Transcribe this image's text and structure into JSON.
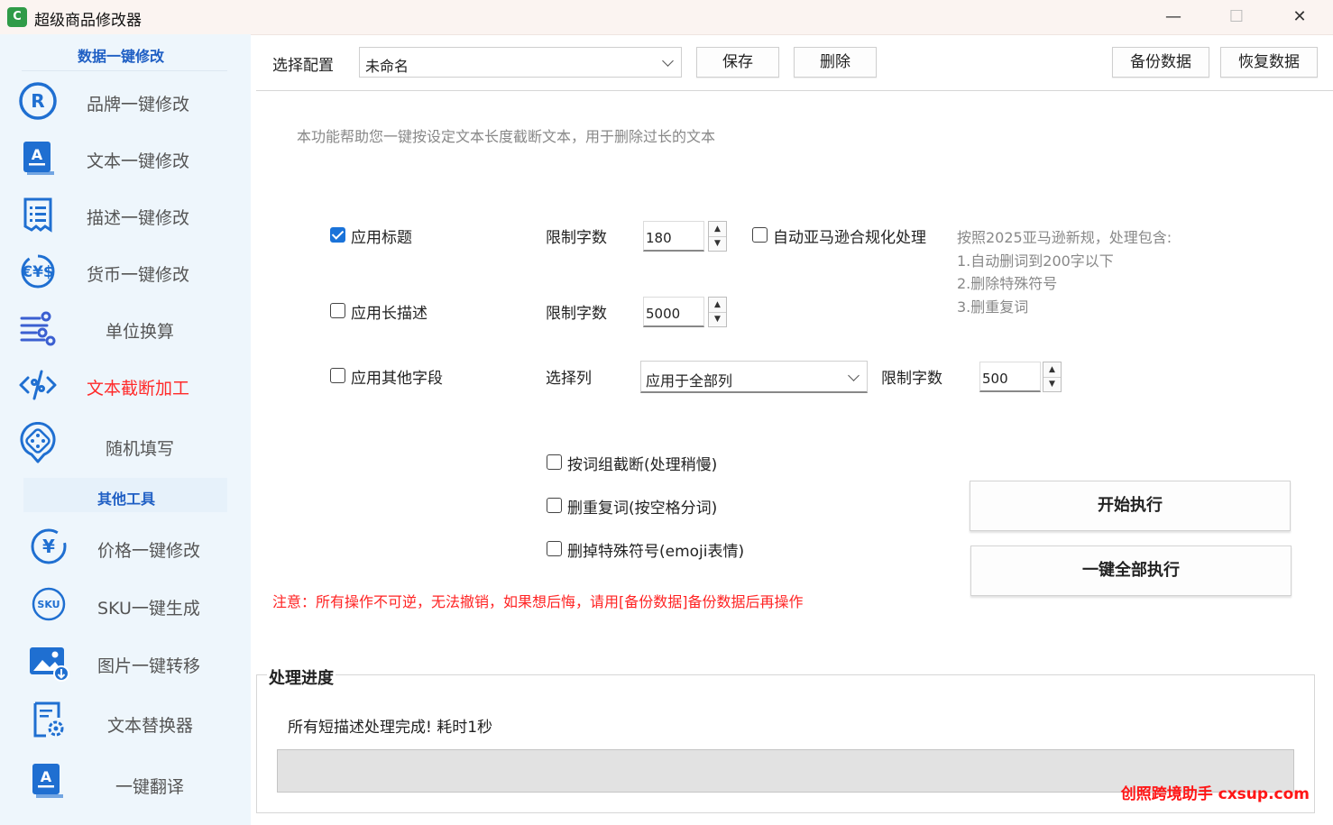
{
  "window": {
    "title": "超级商品修改器",
    "app_icon_glyph": "C",
    "minimize_glyph": "—",
    "maximize_glyph": "☐",
    "close_glyph": "✕"
  },
  "sidebar": {
    "section_main": "数据一键修改",
    "items": [
      {
        "label": "品牌一键修改",
        "icon": "registered-icon"
      },
      {
        "label": "文本一键修改",
        "icon": "document-a-icon"
      },
      {
        "label": "描述一键修改",
        "icon": "receipt-list-icon"
      },
      {
        "label": "货币一键修改",
        "icon": "currency-icon"
      },
      {
        "label": "单位换算",
        "icon": "sliders-icon"
      },
      {
        "label": "文本截断加工",
        "icon": "code-cut-icon",
        "active": true
      },
      {
        "label": "随机填写",
        "icon": "dice-pin-icon"
      }
    ],
    "section_other": "其他工具",
    "other_items": [
      {
        "label": "价格一键修改",
        "icon": "yuan-icon"
      },
      {
        "label": "SKU一键生成",
        "icon": "sku-icon"
      },
      {
        "label": "图片一键转移",
        "icon": "image-download-icon"
      },
      {
        "label": "文本替换器",
        "icon": "doc-gear-icon"
      },
      {
        "label": "一键翻译",
        "icon": "translate-doc-icon"
      }
    ],
    "sku_text": "SKU",
    "active_color": "#ff2a2a",
    "icon_color": "#1f6fd1"
  },
  "topbar": {
    "config_label": "选择配置",
    "config_value": "未命名",
    "save_label": "保存",
    "delete_label": "删除",
    "backup_label": "备份数据",
    "restore_label": "恢复数据"
  },
  "main": {
    "intro": "本功能帮助您一键按设定文本长度截断文本，用于删除过长的文本",
    "apply_title": {
      "label": "应用标题",
      "checked": true,
      "limit_label": "限制字数",
      "limit_value": "180"
    },
    "auto_amazon": {
      "label": "自动亚马逊合规化处理",
      "checked": false
    },
    "amazon_notes": [
      "按照2025亚马逊新规，处理包含:",
      "1.自动删词到200字以下",
      "2.删除特殊符号",
      "3.删重复词"
    ],
    "apply_long_desc": {
      "label": "应用长描述",
      "checked": false,
      "limit_label": "限制字数",
      "limit_value": "5000"
    },
    "apply_other": {
      "label": "应用其他字段",
      "checked": false,
      "column_label": "选择列",
      "column_value": "应用于全部列",
      "limit_label": "限制字数",
      "limit_value": "500"
    },
    "opt_word_group": {
      "label": "按词组截断(处理稍慢)",
      "checked": false
    },
    "opt_dedupe": {
      "label": "删重复词(按空格分词)",
      "checked": false
    },
    "opt_remove_special": {
      "label": "删掉特殊符号(emoji表情)",
      "checked": false
    },
    "warning": "注意：所有操作不可逆，无法撤销，如果想后悔，请用[备份数据]备份数据后再操作",
    "start_label": "开始执行",
    "run_all_label": "一键全部执行",
    "spin_up": "▲",
    "spin_down": "▼"
  },
  "progress": {
    "title": "处理进度",
    "status": "所有短描述处理完成! 耗时1秒",
    "percent": 0
  },
  "watermark": "创照跨境助手 cxsup.com"
}
